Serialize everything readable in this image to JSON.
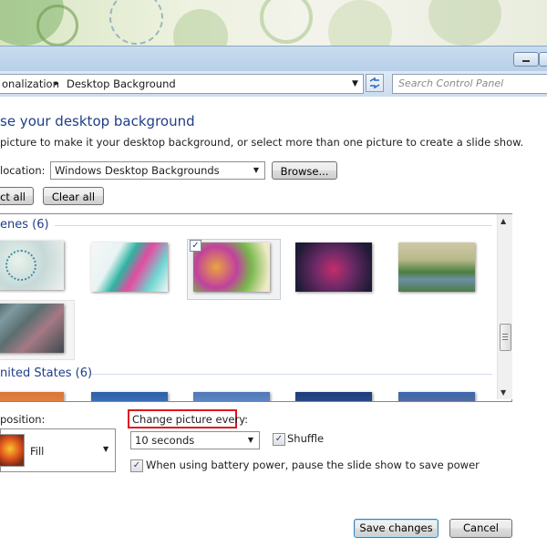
{
  "address": {
    "crumb_parent": "onalization",
    "crumb_separator": "▸",
    "crumb_current": "Desktop Background",
    "search_placeholder": "Search Control Panel"
  },
  "content": {
    "heading": "se your desktop background",
    "instruction": "picture to make it your desktop background, or select more than one picture to create a slide show.",
    "location_label": "location:",
    "location_value": "Windows Desktop Backgrounds",
    "browse_label": "Browse...",
    "select_all_label": "ct all",
    "clear_all_label": "Clear all"
  },
  "groups": [
    {
      "title": "enes (6)"
    },
    {
      "title": "nited States (6)"
    }
  ],
  "position": {
    "label": "position:",
    "value": "Fill"
  },
  "interval": {
    "label": "Change picture every:",
    "value": "10 seconds",
    "shuffle_label": "Shuffle",
    "shuffle_checked": true,
    "battery_label": "When using battery power, pause the slide show to save power",
    "battery_checked": true
  },
  "footer": {
    "save_label": "Save changes",
    "cancel_label": "Cancel"
  },
  "colors": {
    "link_blue": "#1e3e88",
    "highlight_red": "#e0141e"
  }
}
